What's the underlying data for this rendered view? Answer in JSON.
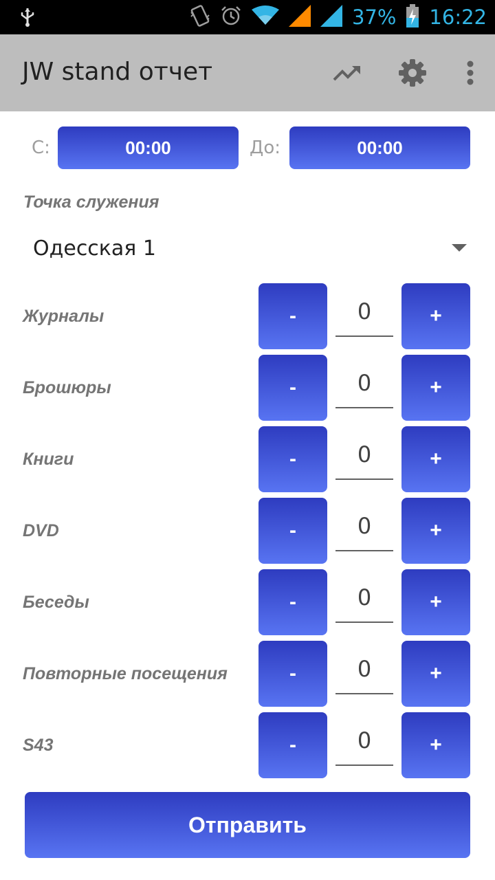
{
  "status_bar": {
    "battery_percent": "37%",
    "time": "16:22",
    "icons": [
      "usb-icon",
      "vibrate-icon",
      "alarm-icon",
      "wifi-icon",
      "signal-icon",
      "battery-charging-icon"
    ]
  },
  "app_bar": {
    "title": "JW stand отчет",
    "actions": [
      "trending-up-icon",
      "gear-icon",
      "overflow-menu-icon"
    ]
  },
  "time_range": {
    "from_label": "С:",
    "from_value": "00:00",
    "to_label": "До:",
    "to_value": "00:00"
  },
  "location": {
    "label": "Точка служения",
    "selected": "Одесская 1"
  },
  "counters": [
    {
      "label": "Журналы",
      "value": "0",
      "minus": "-",
      "plus": "+"
    },
    {
      "label": "Брошюры",
      "value": "0",
      "minus": "-",
      "plus": "+"
    },
    {
      "label": "Книги",
      "value": "0",
      "minus": "-",
      "plus": "+"
    },
    {
      "label": "DVD",
      "value": "0",
      "minus": "-",
      "plus": "+"
    },
    {
      "label": "Беседы",
      "value": "0",
      "minus": "-",
      "plus": "+"
    },
    {
      "label": "Повторные посещения",
      "value": "0",
      "minus": "-",
      "plus": "+"
    },
    {
      "label": "S43",
      "value": "0",
      "minus": "-",
      "plus": "+"
    }
  ],
  "submit_label": "Отправить",
  "colors": {
    "accent_top": "#2e3cc0",
    "accent_bottom": "#5874f2",
    "status_icon": "#33b5e5",
    "signal_orange": "#ff8a00",
    "app_bar": "#bdbdbd"
  }
}
